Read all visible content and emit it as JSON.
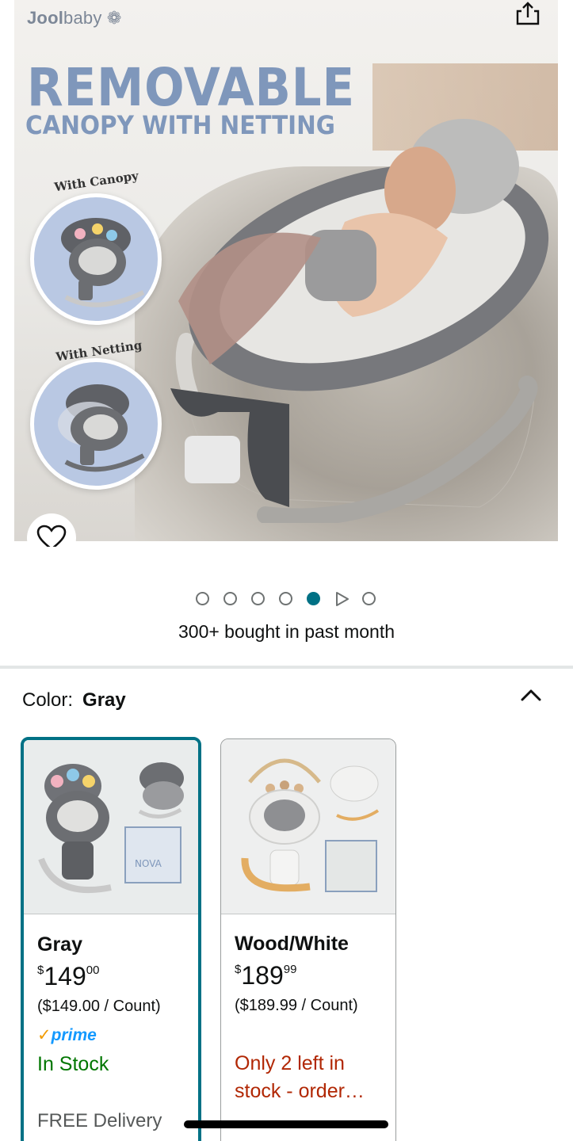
{
  "hero": {
    "brand_bold": "Jool",
    "brand_rest": "baby",
    "headline_1": "REMOVABLE",
    "headline_2": "CANOPY WITH NETTING",
    "badge_1": "With Canopy",
    "badge_2": "With Netting",
    "product_badge": "NOVA",
    "share_icon": "share-icon",
    "favorite_icon": "heart-icon"
  },
  "carousel": {
    "total_items": 7,
    "active_index": 4,
    "video_index": 5,
    "accent_color": "#007185"
  },
  "social_proof": "300+ bought in past month",
  "color_selector": {
    "label": "Color:",
    "selected": "Gray",
    "collapse_icon": "chevron-up-icon",
    "options": [
      {
        "name": "Gray",
        "price_symbol": "$",
        "price_whole": "149",
        "price_fraction": "00",
        "unit_price": "($149.00 / Count)",
        "prime_check": "✓",
        "prime_label": "prime",
        "stock": "In Stock",
        "delivery": "FREE Delivery",
        "selected": true
      },
      {
        "name": "Wood/White",
        "price_symbol": "$",
        "price_whole": "189",
        "price_fraction": "99",
        "unit_price": "($189.99 / Count)",
        "stock": "Only 2 left in stock - order…",
        "selected": false
      }
    ]
  },
  "colors": {
    "selected_border": "#007185",
    "in_stock": "#007600",
    "low_stock": "#b12704",
    "prime_blue": "#1399ff",
    "headline": "#7f97bb"
  }
}
